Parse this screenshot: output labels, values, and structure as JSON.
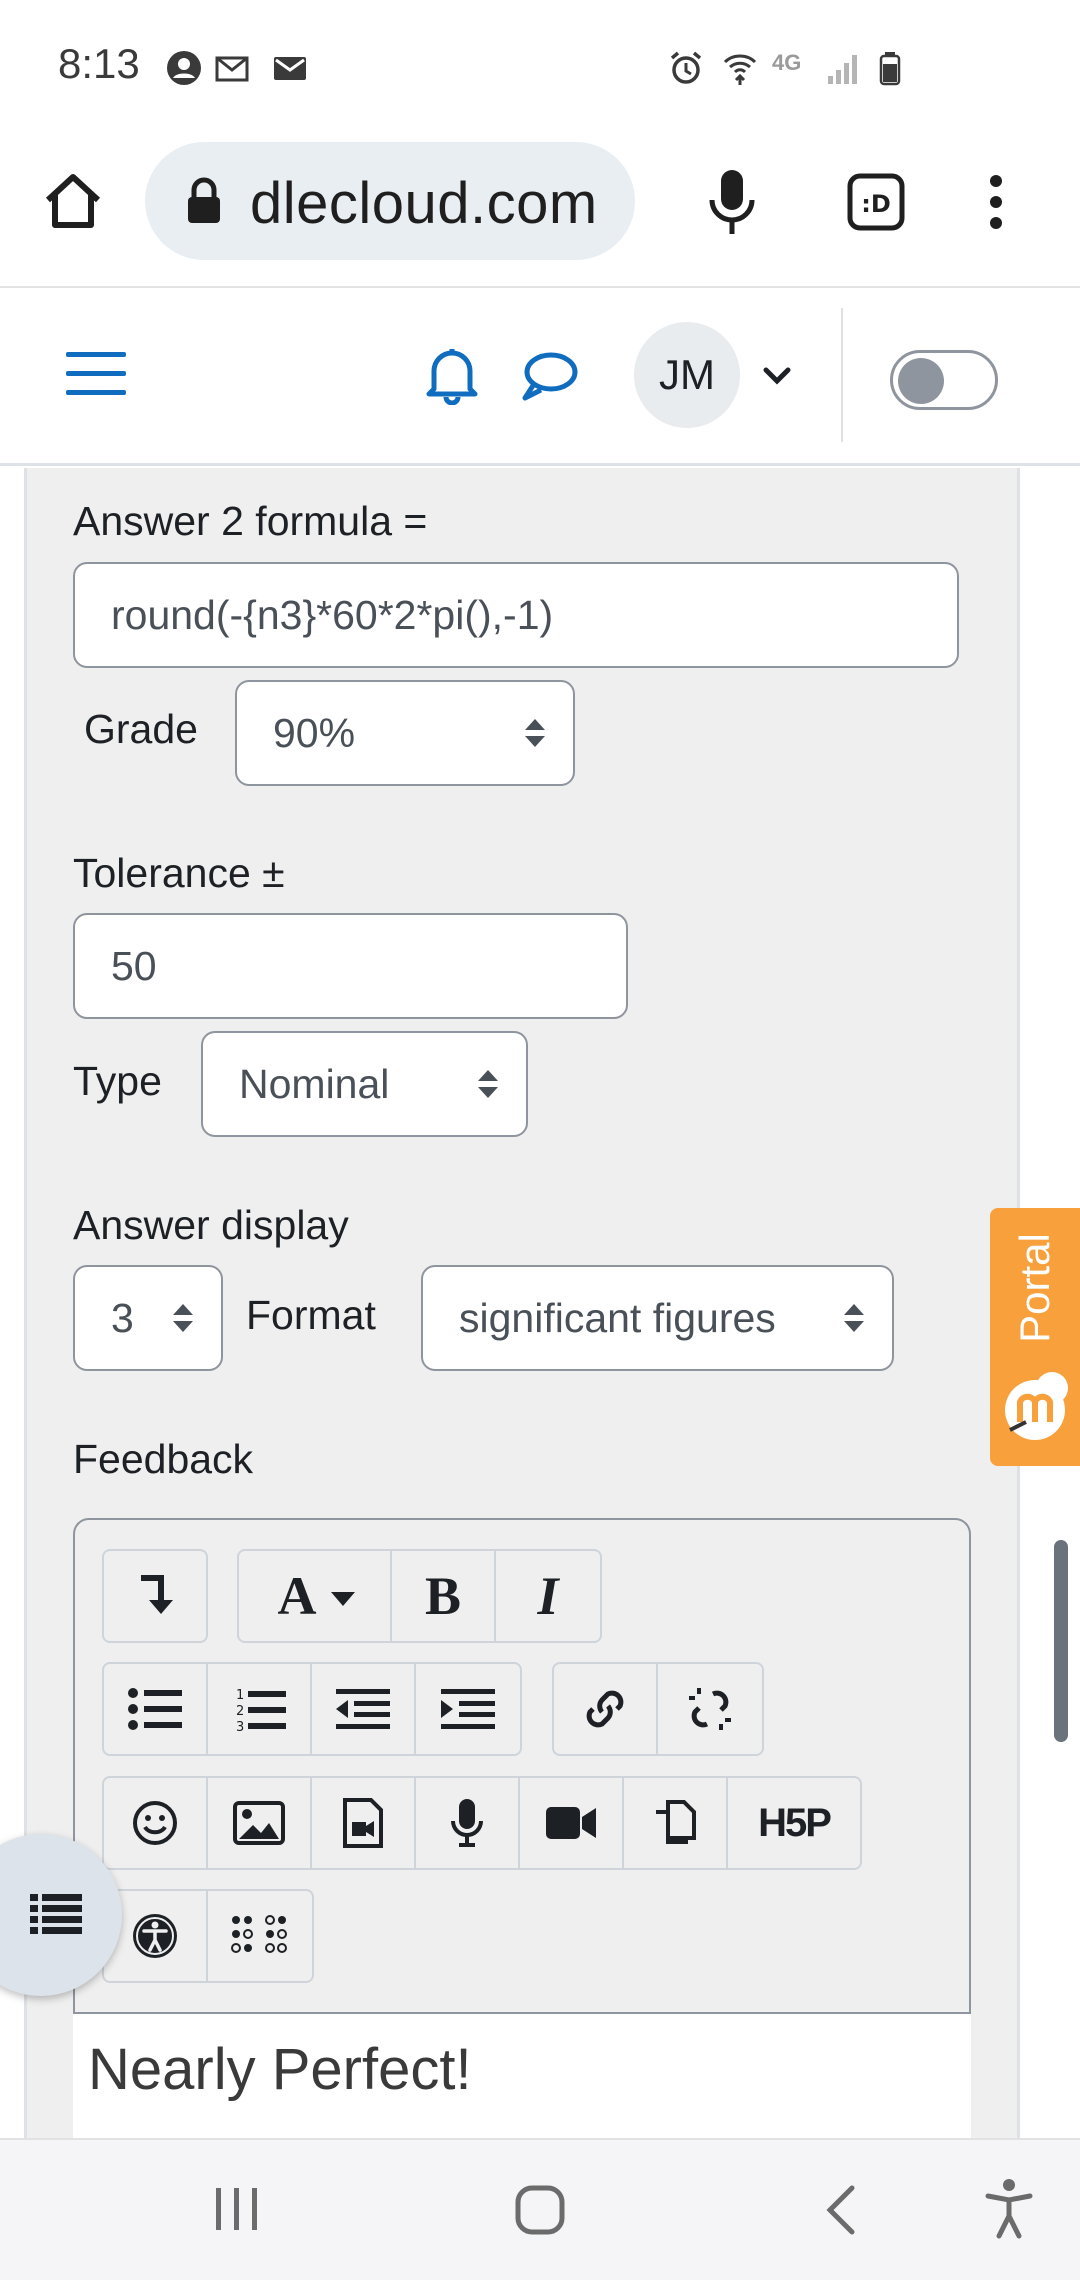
{
  "status_bar": {
    "time": "8:13",
    "network_label": "4G"
  },
  "browser": {
    "url_fragment": "dlecloud.com",
    "icons": [
      "home-icon",
      "lock-icon",
      "mic-icon",
      "tab-switcher-icon",
      "more-vert-icon"
    ]
  },
  "nav": {
    "avatar_initials": "JM",
    "icons": [
      "hamburger-menu-icon",
      "bell-icon",
      "chat-icon",
      "chevron-down-icon"
    ]
  },
  "form": {
    "answer2_label": "Answer 2 formula =",
    "answer2_value": "round(-{n3}*60*2*pi(),-1)",
    "grade_label": "Grade",
    "grade_value": "90%",
    "tolerance_label": "Tolerance ±",
    "tolerance_value": "50",
    "type_label": "Type",
    "type_value": "Nominal",
    "answer_display_label": "Answer display",
    "answer_display_value": "3",
    "format_label": "Format",
    "format_value": "significant figures",
    "feedback_label": "Feedback"
  },
  "editor": {
    "text": "Nearly Perfect!",
    "h5p_label": "H5P"
  },
  "portal": {
    "label": "Portal"
  },
  "colors": {
    "link_blue": "#0f6cbf",
    "portal_orange": "#f7a03c",
    "panel_bg": "#efefef"
  }
}
